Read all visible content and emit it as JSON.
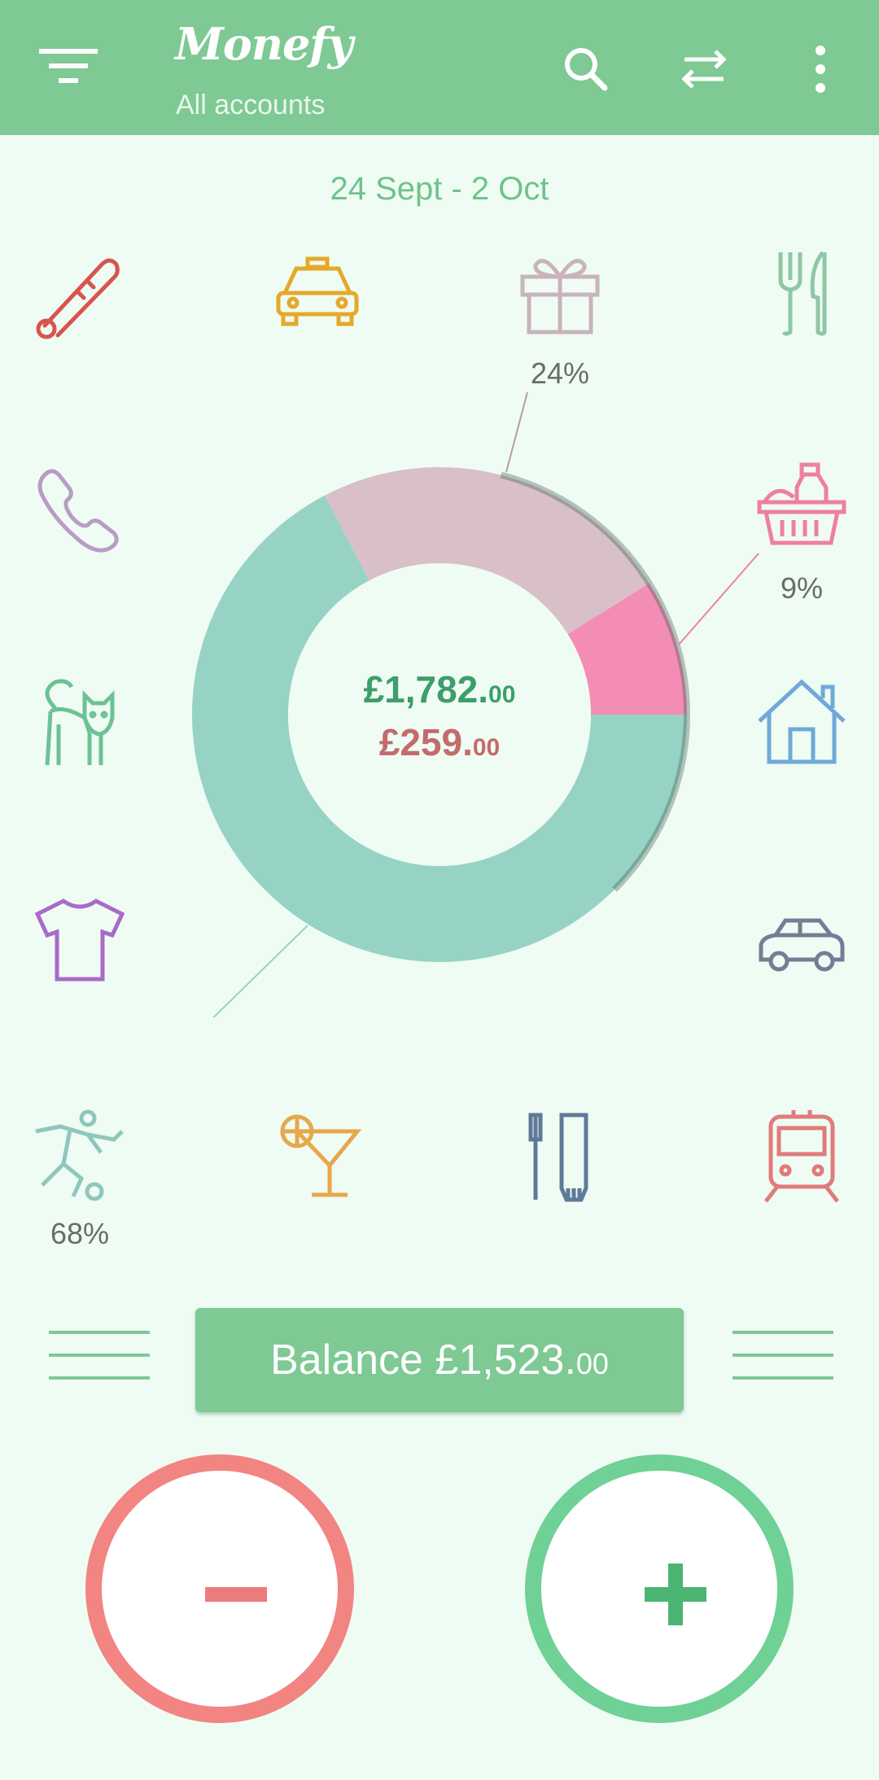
{
  "app": {
    "title": "Monefy",
    "subtitle": "All accounts"
  },
  "toolbar": {
    "icons": [
      "filter-menu-icon",
      "search-icon",
      "transfer-icon",
      "more-vert-icon"
    ]
  },
  "period": "24 Sept - 2 Oct",
  "categories": [
    {
      "icon": "thermometer-icon",
      "color": "#d9534f"
    },
    {
      "icon": "taxi-icon",
      "color": "#e6a82a"
    },
    {
      "icon": "gift-icon",
      "color": "#c9b3bc",
      "percent": "24%"
    },
    {
      "icon": "cutlery-icon",
      "color": "#8fc7a6"
    },
    {
      "icon": "phone-icon",
      "color": "#b99cc6"
    },
    {
      "icon": "basket-icon",
      "color": "#ee7fa3",
      "percent": "9%"
    },
    {
      "icon": "cat-icon",
      "color": "#6cc294"
    },
    {
      "icon": "house-icon",
      "color": "#6ea9d9"
    },
    {
      "icon": "tshirt-icon",
      "color": "#a86bc9"
    },
    {
      "icon": "car-icon",
      "color": "#6f7f95"
    },
    {
      "icon": "football-icon",
      "color": "#8fc7bd",
      "percent": "68%"
    },
    {
      "icon": "cocktail-icon",
      "color": "#e6a84a"
    },
    {
      "icon": "toothbrush-icon",
      "color": "#5f7a99"
    },
    {
      "icon": "train-icon",
      "color": "#e07b7b"
    }
  ],
  "summary": {
    "income_main": "£1,782.",
    "income_cents": "00",
    "expense_main": "£259.",
    "expense_cents": "00"
  },
  "balance": {
    "label": "Balance £1,523.",
    "cents": "00"
  },
  "chart_data": {
    "type": "pie",
    "series": [
      {
        "label": "68%",
        "value": 68,
        "color": "#97d3c4"
      },
      {
        "label": "24%",
        "value": 24,
        "color": "#d8bfc8"
      },
      {
        "label": "9%",
        "value": 9,
        "color": "#f48db5"
      }
    ]
  },
  "buttons": {
    "expense": "−",
    "income": "+"
  }
}
